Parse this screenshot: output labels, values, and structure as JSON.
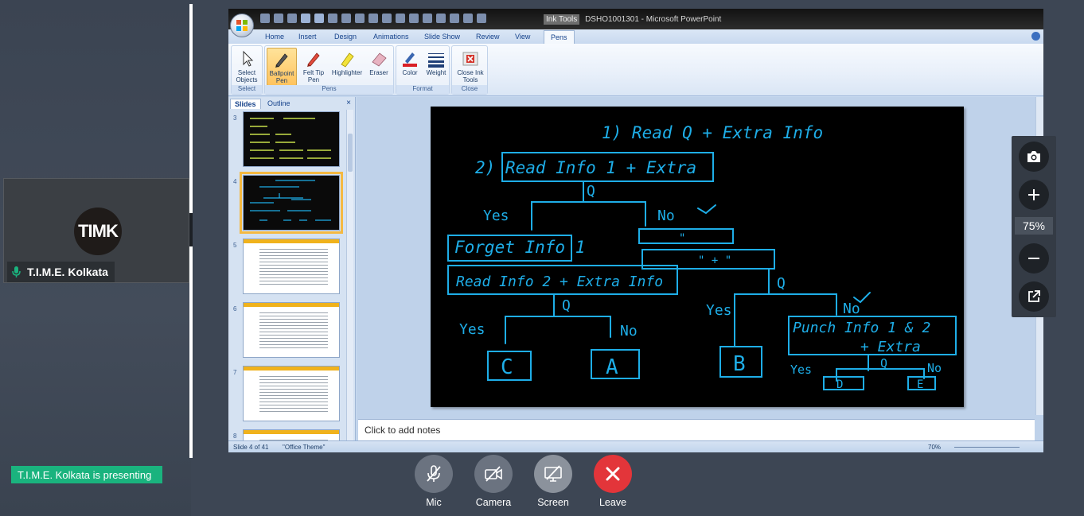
{
  "participant": {
    "initials": "TIMK",
    "name": "T.I.M.E. Kolkata",
    "mic_icon": "microphone-icon"
  },
  "presenter_banner": "T.I.M.E. Kolkata is presenting",
  "ppt": {
    "ink_tools_label": "Ink Tools",
    "title": "DSHO1001301 - Microsoft PowerPoint",
    "tabs": [
      {
        "label": "Home"
      },
      {
        "label": "Insert"
      },
      {
        "label": "Design"
      },
      {
        "label": "Animations"
      },
      {
        "label": "Slide Show"
      },
      {
        "label": "Review"
      },
      {
        "label": "View"
      },
      {
        "label": "Pens"
      }
    ],
    "ribbon": {
      "select_objects": "Select Objects",
      "ballpoint_pen": "Ballpoint Pen",
      "felt_tip_pen": "Felt Tip Pen",
      "highlighter": "Highlighter",
      "eraser": "Eraser",
      "color": "Color",
      "weight": "Weight",
      "close_ink_tools": "Close Ink Tools",
      "groups": {
        "select": "Select",
        "pens": "Pens",
        "format": "Format",
        "close": "Close"
      }
    },
    "pane_tabs": {
      "slides": "Slides",
      "outline": "Outline"
    },
    "thumbnails": [
      {
        "num": "3"
      },
      {
        "num": "4"
      },
      {
        "num": "5"
      },
      {
        "num": "6"
      },
      {
        "num": "7"
      },
      {
        "num": "8"
      }
    ],
    "slide_ink": {
      "line1": "1) Read Q + Extra Info",
      "line2": "2) Read Info 1 + Extra",
      "q1": "Q",
      "yes1": "Yes",
      "no1": "No",
      "forget": "Forget Info 1",
      "ditto1": "\"",
      "ditto2": "\" + \"",
      "read2": "Read Info 2 + Extra Info",
      "q2": "Q",
      "yes2": "Yes",
      "no2": "No",
      "q3": "Q",
      "yes3": "Yes",
      "no3": "No",
      "punch1": "Punch Info 1 & 2",
      "punch2": "+ Extra",
      "q4": "Q",
      "yes4": "Yes",
      "no4": "No",
      "c": "C",
      "a": "A",
      "b": "B",
      "d": "D",
      "e": "E"
    },
    "notes_placeholder": "Click to add notes",
    "status": {
      "slide": "Slide 4 of 41",
      "theme": "\"Office Theme\"",
      "zoom": "70%"
    }
  },
  "zoom_panel": {
    "level": "75%"
  },
  "controls": [
    {
      "label": "Mic"
    },
    {
      "label": "Camera"
    },
    {
      "label": "Screen"
    },
    {
      "label": "Leave"
    }
  ],
  "colors": {
    "ink": "#1eaee8",
    "leave": "#e3353a",
    "presenting": "#1ab37e"
  }
}
